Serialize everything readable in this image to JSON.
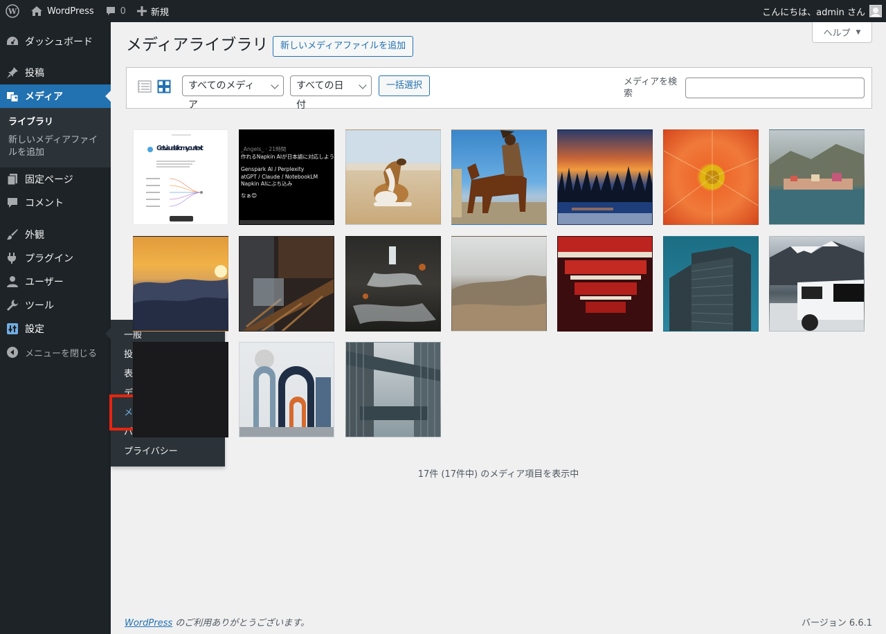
{
  "adminbar": {
    "site_name": "WordPress",
    "comments_count": "0",
    "new_label": "新規",
    "greeting": "こんにちは、admin さん"
  },
  "sidebar": {
    "items": [
      {
        "label": "ダッシュボード",
        "icon": "dashboard-icon"
      },
      {
        "label": "投稿",
        "icon": "pin-icon"
      },
      {
        "label": "メディア",
        "icon": "media-icon"
      },
      {
        "label": "固定ページ",
        "icon": "page-icon"
      },
      {
        "label": "コメント",
        "icon": "comment-icon"
      },
      {
        "label": "外観",
        "icon": "brush-icon"
      },
      {
        "label": "プラグイン",
        "icon": "plugin-icon"
      },
      {
        "label": "ユーザー",
        "icon": "user-icon"
      },
      {
        "label": "ツール",
        "icon": "wrench-icon"
      },
      {
        "label": "設定",
        "icon": "settings-icon"
      }
    ],
    "media_submenu": [
      "ライブラリ",
      "新しいメディアファイルを追加"
    ],
    "collapse_label": "メニューを閉じる"
  },
  "settings_flyout": [
    "一般",
    "投稿設定",
    "表示設定",
    "ディスカッション",
    "メディア",
    "パーマリンク",
    "プライバシー"
  ],
  "help_label": "ヘルプ",
  "page": {
    "title": "メディアライブラリ",
    "add_new_label": "新しいメディアファイルを追加"
  },
  "toolbar": {
    "filter_type": "すべてのメディア",
    "filter_date": "すべての日付",
    "bulk_select_label": "一括選択",
    "search_label": "メディアを検索"
  },
  "media_tiles": [
    {
      "desc": "napkin-screenshot",
      "text_title": "Get visuals from your text"
    },
    {
      "desc": "black-tweet-screenshot",
      "text_lines": [
        "_Angels_ · 21時間",
        "作れるNapkin AIが日本語に対応しよう",
        "Genspark AI / Perplexity",
        "atGPT / Claude / NotebookLM",
        "Napkin AIにぶち込み",
        "なぁ😊"
      ]
    },
    {
      "desc": "dog-on-beach"
    },
    {
      "desc": "eagle-hunter-on-horse"
    },
    {
      "desc": "sunset-lake-forest"
    },
    {
      "desc": "orange-flower"
    },
    {
      "desc": "coastal-town"
    },
    {
      "desc": "sunset-over-clouds"
    },
    {
      "desc": "steel-bridge-architecture"
    },
    {
      "desc": "forest-waterfall"
    },
    {
      "desc": "misty-mountain"
    },
    {
      "desc": "red-pagoda"
    },
    {
      "desc": "glass-skyscraper"
    },
    {
      "desc": "white-jeep-snow-mountains"
    },
    {
      "desc": "dark-abstract"
    },
    {
      "desc": "abstract-arches"
    },
    {
      "desc": "glass-skybridge"
    }
  ],
  "status_text": "17件 (17件中) のメディア項目を表示中",
  "footer": {
    "link_text": "WordPress",
    "thanks_text": " のご利用ありがとうございます。",
    "version": "バージョン 6.6.1"
  }
}
